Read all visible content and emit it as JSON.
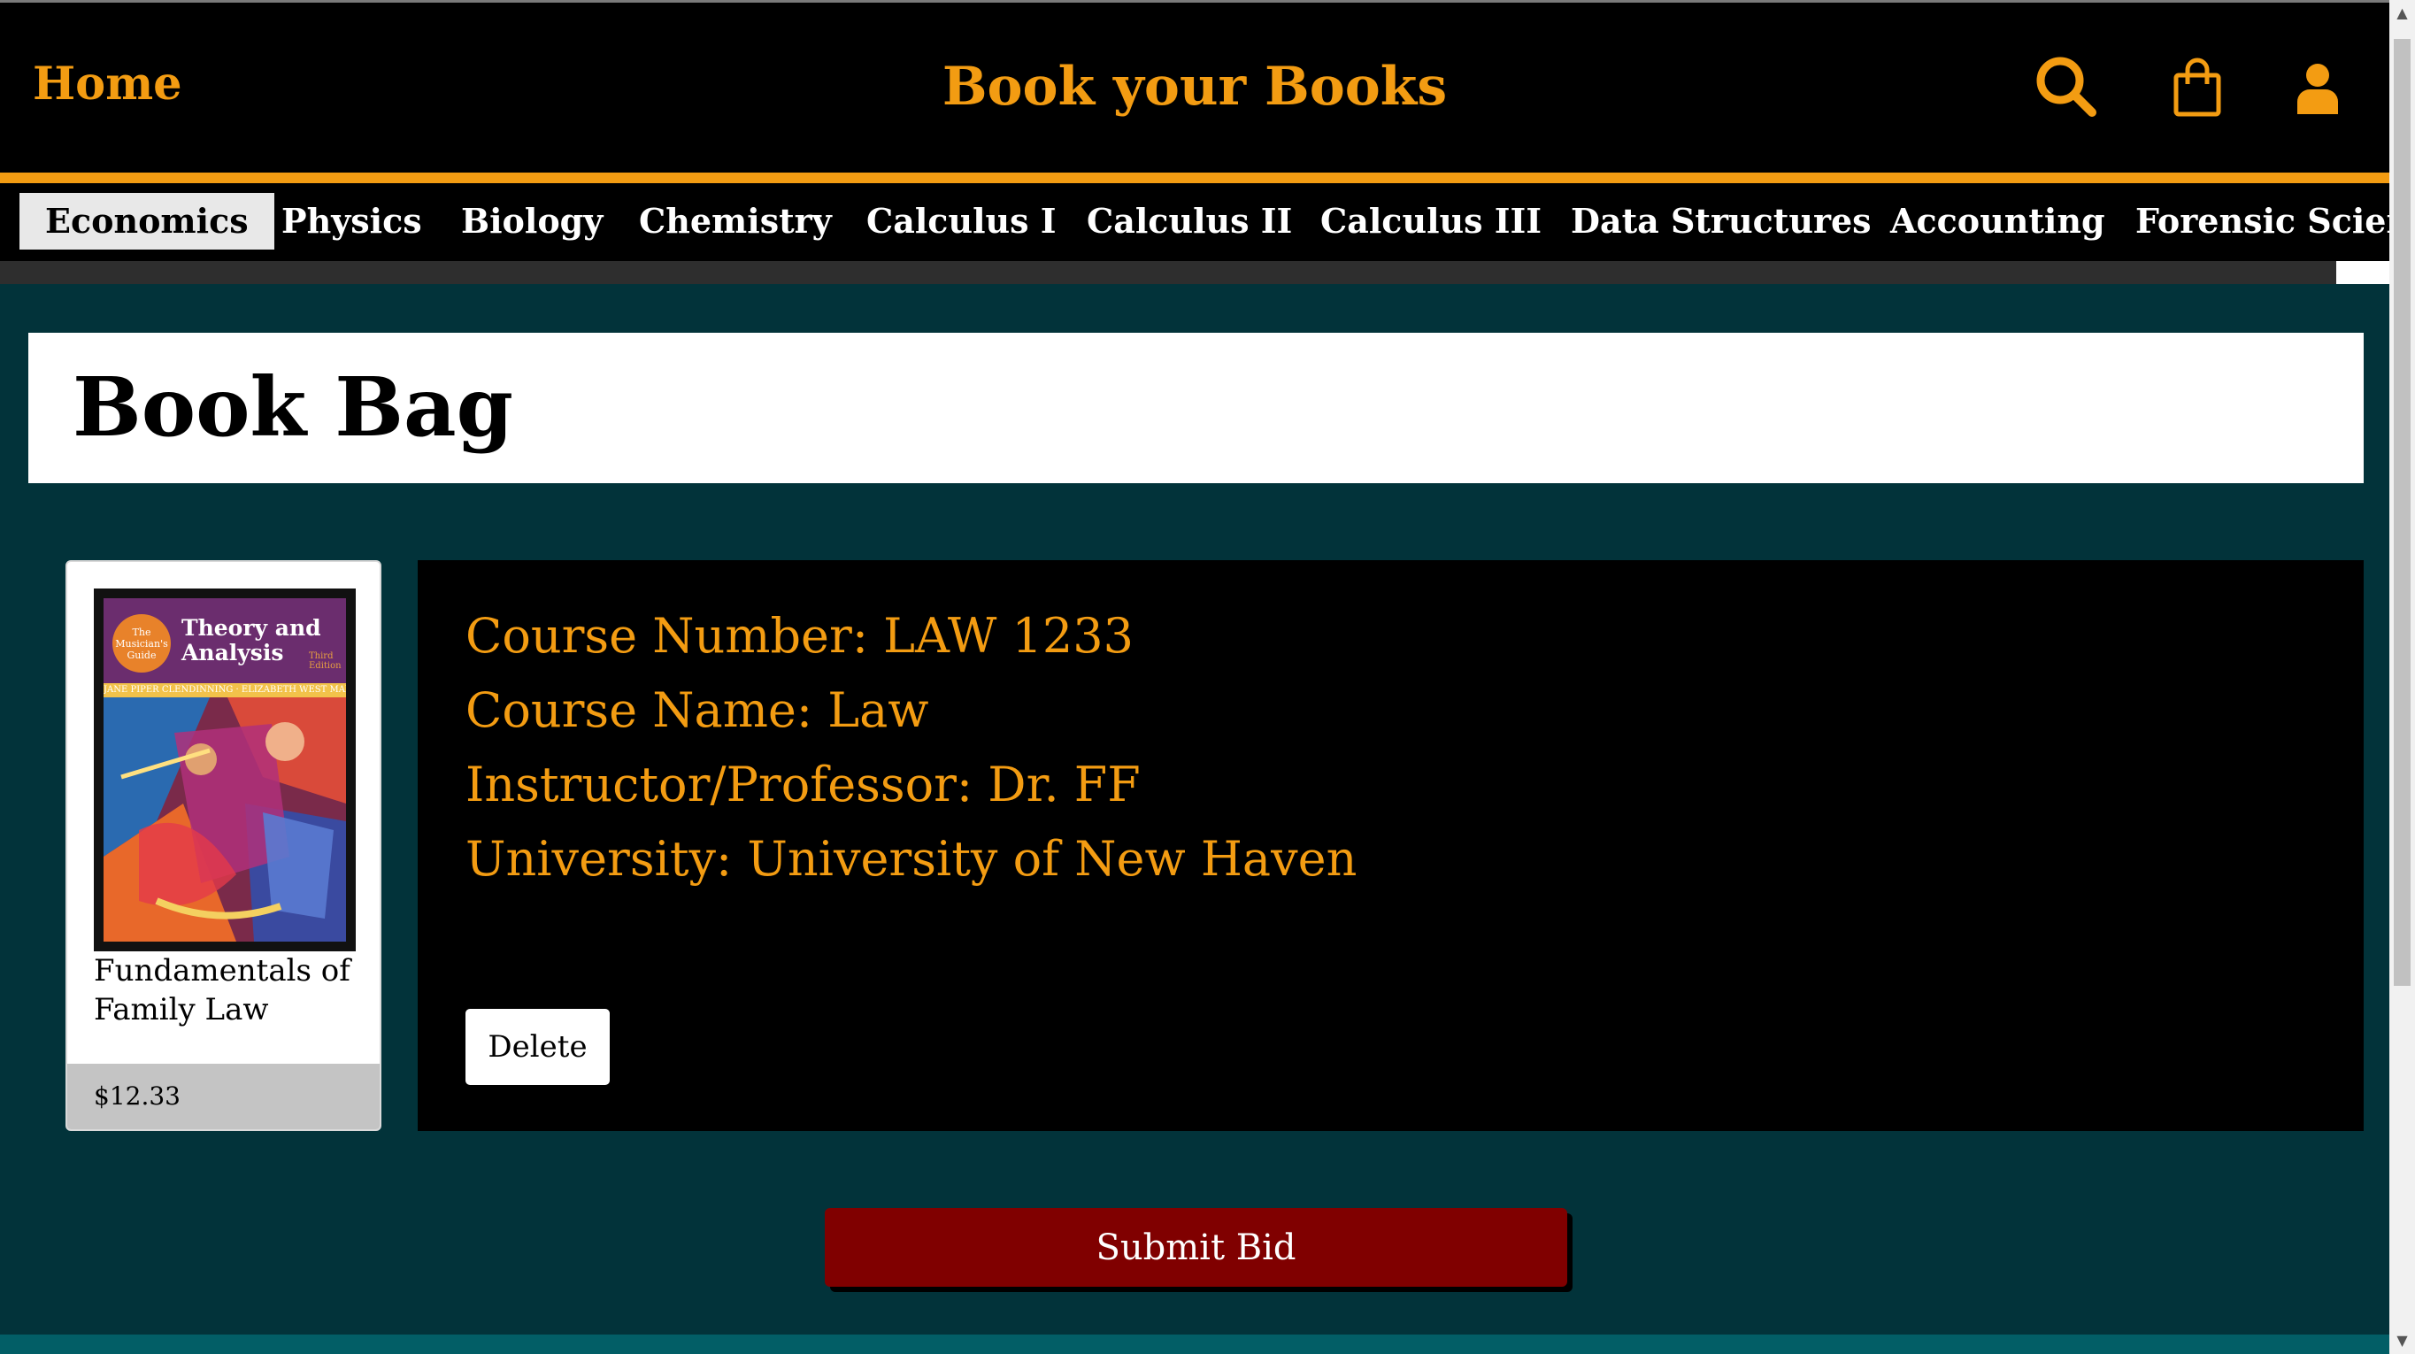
{
  "header": {
    "home_label": "Home",
    "site_title": "Book your Books",
    "icons": [
      "search-icon",
      "shopping-bag-icon",
      "user-icon"
    ],
    "accent_color": "#f39c12"
  },
  "nav": {
    "items": [
      {
        "label": "Economics",
        "active": true
      },
      {
        "label": "Physics"
      },
      {
        "label": "Biology"
      },
      {
        "label": "Chemistry"
      },
      {
        "label": "Calculus I"
      },
      {
        "label": "Calculus II"
      },
      {
        "label": "Calculus III"
      },
      {
        "label": "Data Structures"
      },
      {
        "label": "Accounting"
      },
      {
        "label": "Forensic Science"
      }
    ]
  },
  "page": {
    "heading": "Book Bag"
  },
  "cart_item": {
    "cover": {
      "badge": "The Musician's Guide",
      "title_line1": "Theory and",
      "title_line2": "Analysis",
      "edition": "Third Edition",
      "authors": "JANE PIPER CLENDINNING · ELIZABETH WEST MARVIN"
    },
    "book_name": "Fundamentals of Family Law",
    "price": "$12.33",
    "course_number": "Course Number: LAW 1233",
    "course_name": "Course Name: Law",
    "instructor": "Instructor/Professor: Dr. FF",
    "university": "University: University of New Haven",
    "delete_label": "Delete"
  },
  "actions": {
    "submit_label": "Submit Bid",
    "submit_color": "#800000"
  },
  "colors": {
    "page_background": "#02333a",
    "panel_background": "#000000"
  }
}
